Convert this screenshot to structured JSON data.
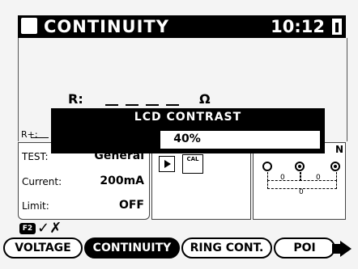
{
  "header": {
    "mode_icon": "function-selector-icon",
    "title": "CONTINUITY",
    "clock": "10:12",
    "battery_icon": "battery-icon"
  },
  "result": {
    "r_label": "R:",
    "unit": "Ω",
    "r_plus_label": "R+:"
  },
  "dialog": {
    "title": "LCD CONTRAST",
    "value_text": "40%",
    "value": 40
  },
  "params": {
    "test_label": "TEST:",
    "test_value": "General",
    "current_label": "Current:",
    "current_value": "200mA",
    "limit_label": "Limit:",
    "limit_value": "OFF"
  },
  "controls": {
    "play_icon": "play-icon",
    "cal_label": "CAL"
  },
  "terminals": {
    "n_label": "N",
    "zero": "0"
  },
  "fkey": {
    "label": "F2",
    "icon": "check-cross-icon",
    "symbol": "✓✗"
  },
  "tabs": [
    {
      "label": "VOLTAGE"
    },
    {
      "label": "CONTINUITY"
    },
    {
      "label": "RING CONT."
    },
    {
      "label": "POI"
    }
  ],
  "colors": {
    "foreground": "#000000",
    "background": "#ffffff"
  }
}
